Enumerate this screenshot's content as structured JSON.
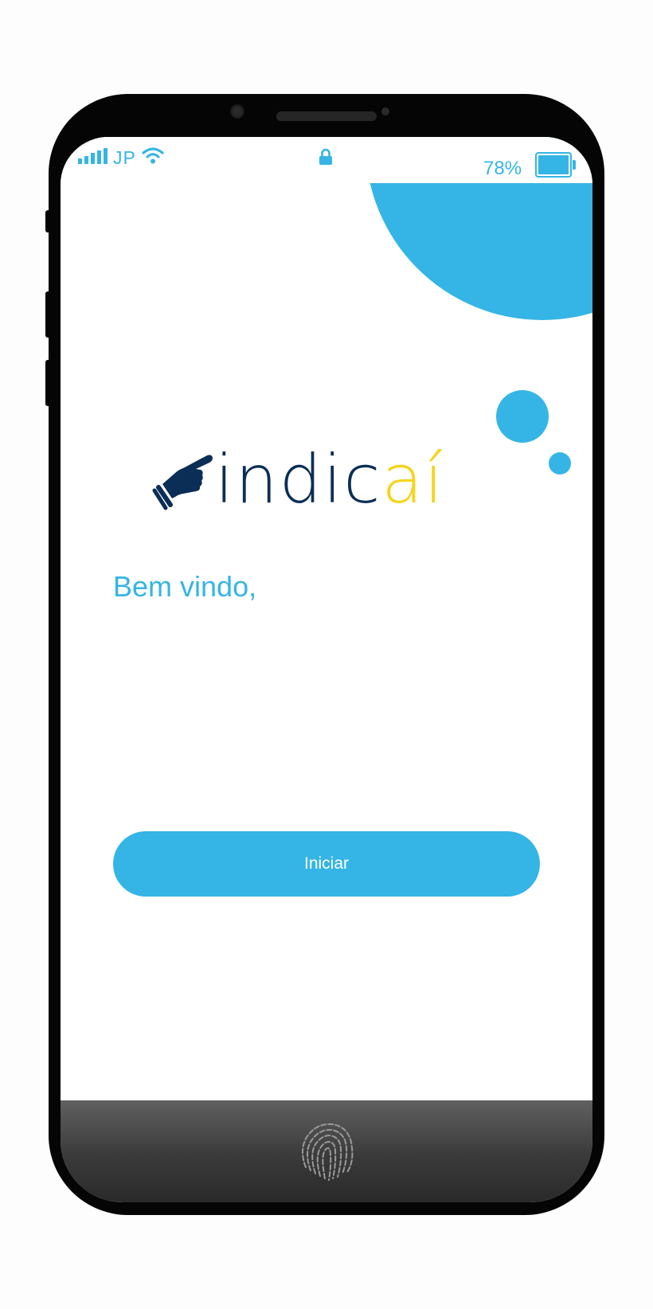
{
  "status_bar": {
    "carrier": "JP",
    "battery_percent": "78%",
    "battery_level": 1.0
  },
  "logo": {
    "part_dark": "indic",
    "part_accent": "aí"
  },
  "welcome": {
    "text": "Bem vindo,"
  },
  "actions": {
    "start_label": "Iniciar"
  },
  "icons": [
    "signal-icon",
    "wifi-icon",
    "lock-icon",
    "battery-icon",
    "pointing-hand-icon",
    "fingerprint-icon"
  ],
  "colors": {
    "accent": "#35b5e5",
    "logo_dark": "#0b2e57",
    "logo_yellow": "#f7d41c"
  }
}
